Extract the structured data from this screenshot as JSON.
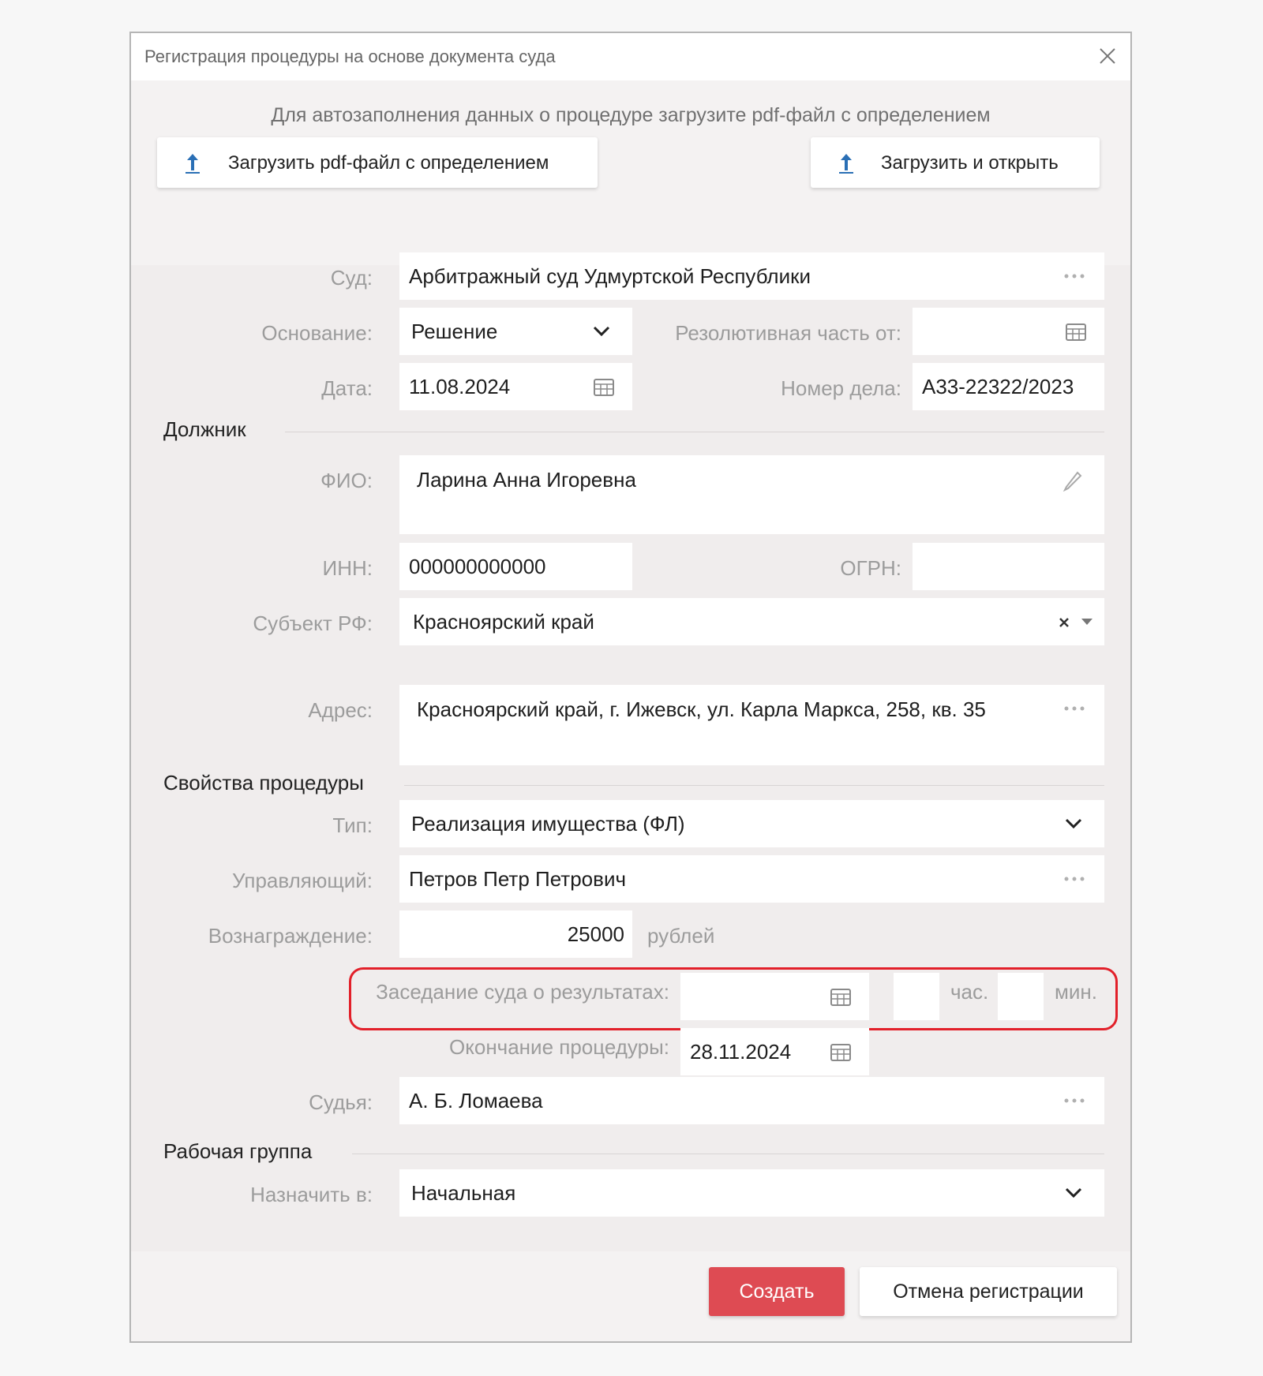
{
  "dialog": {
    "title": "Регистрация процедуры на основе документа суда",
    "upload_hint": "Для автозаполнения данных о процедуре загрузите pdf-файл с определением",
    "upload_button": "Загрузить pdf-файл с определением",
    "upload_open_button": "Загрузить и открыть"
  },
  "court": {
    "label": "Суд:",
    "value": "Арбитражный суд Удмуртской Республики"
  },
  "basis": {
    "label": "Основание:",
    "value": "Решение"
  },
  "resolution": {
    "label": "Резолютивная часть от:",
    "value": ""
  },
  "date": {
    "label": "Дата:",
    "value": "11.08.2024"
  },
  "case_number": {
    "label": "Номер дела:",
    "value": "А33-22322/2023"
  },
  "debtor": {
    "section": "Должник",
    "fio_label": "ФИО:",
    "fio": "Ларина Анна Игоревна",
    "inn_label": "ИНН:",
    "inn": "000000000000",
    "ogrn_label": "ОГРН:",
    "ogrn": "",
    "region_label": "Субъект РФ:",
    "region": "Красноярский край",
    "address_label": "Адрес:",
    "address": "Красноярский край, г. Ижевск, ул. Карла Маркса, 258, кв. 35"
  },
  "procedure": {
    "section": "Свойства процедуры",
    "type_label": "Тип:",
    "type": "Реализация имущества (ФЛ)",
    "manager_label": "Управляющий:",
    "manager": "Петров Петр Петрович",
    "fee_label": "Вознаграждение:",
    "fee": "25000",
    "fee_unit": "рублей",
    "hearing_label": "Заседание суда о результатах:",
    "hearing_date": "",
    "hours": "",
    "hours_unit": "час.",
    "minutes": "",
    "minutes_unit": "мин.",
    "end_label": "Окончание процедуры:",
    "end_date": "28.11.2024",
    "judge_label": "Судья:",
    "judge": "А. Б. Ломаева"
  },
  "workgroup": {
    "section": "Рабочая группа",
    "assign_label": "Назначить в:",
    "assign": "Начальная"
  },
  "footer": {
    "create": "Создать",
    "cancel": "Отмена регистрации"
  },
  "colors": {
    "accent": "#de4b53",
    "highlight": "#e2202a",
    "upload_icon": "#2a6fb5"
  }
}
